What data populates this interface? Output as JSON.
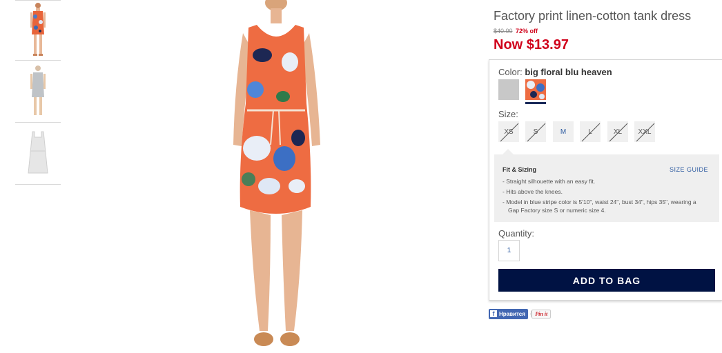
{
  "product": {
    "title": "Factory print linen-cotton tank dress",
    "original_price": "$40.00",
    "percent_off": "72% off",
    "now_price": "Now $13.97"
  },
  "thumbnails": [
    {
      "name": "thumbnail-front-floral"
    },
    {
      "name": "thumbnail-back-grey"
    },
    {
      "name": "thumbnail-white-flat"
    }
  ],
  "color": {
    "label": "Color:",
    "selected_name": "big floral blu heaven",
    "swatches": [
      "grey",
      "big floral blu heaven"
    ]
  },
  "size": {
    "label": "Size:",
    "options": [
      {
        "label": "XS",
        "available": false
      },
      {
        "label": "S",
        "available": false
      },
      {
        "label": "M",
        "available": true
      },
      {
        "label": "L",
        "available": false
      },
      {
        "label": "XL",
        "available": false
      },
      {
        "label": "XXL",
        "available": false
      }
    ]
  },
  "fit": {
    "title": "Fit & Sizing",
    "size_guide": "SIZE GUIDE",
    "points": [
      "- Straight silhouette with an easy fit.",
      "- Hits above the knees.",
      "- Model in blue stripe color is 5'10\", waist 24\", bust 34\", hips 35\", wearing a Gap Factory size S or numeric size 4."
    ]
  },
  "quantity": {
    "label": "Quantity:",
    "value": "1"
  },
  "add_to_bag": "ADD TO BAG",
  "social": {
    "facebook_icon": "f",
    "facebook_label": "Нравится",
    "pinterest_label": "Pin it"
  },
  "colors": {
    "sale_red": "#d0021b",
    "link_blue": "#2c5aa0",
    "button_navy": "#001243"
  }
}
